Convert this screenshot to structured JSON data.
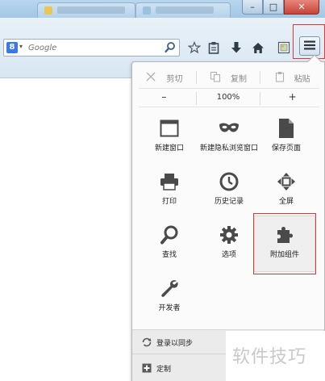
{
  "window": {
    "controls": {
      "minimize": "–",
      "maximize": "□",
      "close": "✕"
    }
  },
  "toolbar": {
    "search": {
      "engine_letter": "8",
      "engine_dropdown": "▾",
      "placeholder": "Google"
    },
    "icons": [
      "search-icon",
      "bookmark-star-icon",
      "clipboard-icon",
      "download-icon",
      "home-icon",
      "screenshot-icon",
      "menu-icon"
    ]
  },
  "menu": {
    "edit": {
      "cut": "剪切",
      "copy": "复制",
      "paste": "粘贴"
    },
    "zoom": {
      "minus": "–",
      "value": "100%",
      "plus": "+"
    },
    "items": [
      {
        "label": "新建窗口",
        "icon": "new-window-icon"
      },
      {
        "label": "新建隐私浏览窗口",
        "icon": "private-mask-icon"
      },
      {
        "label": "保存页面",
        "icon": "save-page-icon"
      },
      {
        "label": "打印",
        "icon": "printer-icon"
      },
      {
        "label": "历史记录",
        "icon": "history-clock-icon"
      },
      {
        "label": "全屏",
        "icon": "fullscreen-icon"
      },
      {
        "label": "查找",
        "icon": "find-magnifier-icon"
      },
      {
        "label": "选项",
        "icon": "options-gear-icon"
      },
      {
        "label": "附加组件",
        "icon": "addons-puzzle-icon"
      },
      {
        "label": "开发者",
        "icon": "developer-wrench-icon"
      }
    ],
    "footer": {
      "sync": "登录以同步",
      "customize": "定制"
    }
  },
  "watermark": "软件技巧",
  "colors": {
    "highlight_border": "#d83a3a",
    "panel_bg": "#fbfbfb",
    "footer_bg": "#ebebeb"
  }
}
